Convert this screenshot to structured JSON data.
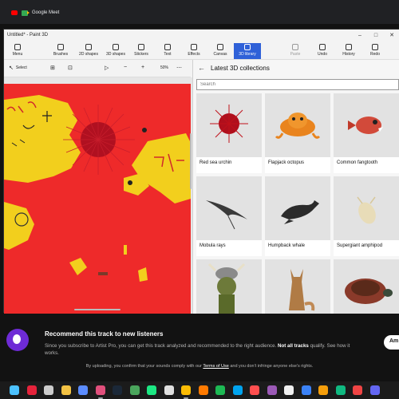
{
  "browser": {
    "tab_label": "Google Meet",
    "tab_icons": [
      "youtube-icon",
      "google-meet-icon"
    ]
  },
  "window": {
    "title": "Untitled* - Paint 3D",
    "controls": [
      "minimize-icon",
      "maximize-icon",
      "close-icon"
    ]
  },
  "ribbon": {
    "items": [
      {
        "label": "Menu",
        "icon": "folder-icon"
      },
      {
        "label": "Brushes",
        "icon": "brush-icon"
      },
      {
        "label": "2D shapes",
        "icon": "2d-shapes-icon"
      },
      {
        "label": "3D shapes",
        "icon": "3d-shapes-icon"
      },
      {
        "label": "Stickers",
        "icon": "stickers-icon"
      },
      {
        "label": "Text",
        "icon": "text-icon"
      },
      {
        "label": "Effects",
        "icon": "effects-icon"
      },
      {
        "label": "Canvas",
        "icon": "canvas-icon"
      },
      {
        "label": "3D library",
        "icon": "3d-library-icon",
        "active": true
      }
    ],
    "right_items": [
      {
        "label": "Paste",
        "icon": "paste-icon",
        "disabled": true
      },
      {
        "label": "Undo",
        "icon": "undo-icon"
      },
      {
        "label": "History",
        "icon": "history-icon"
      },
      {
        "label": "Redo",
        "icon": "redo-icon"
      }
    ]
  },
  "toolbar": {
    "select_label": "Select",
    "zoom_level": "50%",
    "icons": [
      "select-icon",
      "crop-icon",
      "magic-select-icon",
      "view-icon",
      "zoom-out-icon",
      "zoom-in-icon",
      "more-icon"
    ]
  },
  "library": {
    "title": "Latest 3D collections",
    "search_placeholder": "Search",
    "items": [
      {
        "label": "Red sea urchin",
        "color": "#c0111a"
      },
      {
        "label": "Flapjack octopus",
        "color": "#e9841e"
      },
      {
        "label": "Common fangtooth",
        "color": "#d24a3a"
      },
      {
        "label": "Mobula rays",
        "color": "#3a3a3a"
      },
      {
        "label": "Humpback whale",
        "color": "#2b2b2b"
      },
      {
        "label": "Supergiant amphipod",
        "color": "#e8dcb8"
      },
      {
        "label": "",
        "color": "#6d7a3a"
      },
      {
        "label": "",
        "color": "#b07b45"
      },
      {
        "label": "",
        "color": "#8a3a2a"
      }
    ]
  },
  "notification": {
    "title": "Recommend this track to new listeners",
    "body_prefix": "Since you subscribe to Artist Pro, you can get this track analyzed and recommended to the right audience. ",
    "body_bold": "Not all tracks",
    "body_tail": "qualify. See how it works.",
    "button": "Am"
  },
  "terms": {
    "prefix": "By uploading, you confirm that your sounds comply with our ",
    "link": "Terms of Use",
    "suffix": " and you don't infringe anyone else's rights."
  },
  "taskbar": {
    "icons": [
      {
        "name": "start-icon",
        "color": "#4cc2ff"
      },
      {
        "name": "opera-icon",
        "color": "#e5233b"
      },
      {
        "name": "task-view-icon",
        "color": "#cccccc"
      },
      {
        "name": "file-explorer-icon",
        "color": "#f3c244"
      },
      {
        "name": "app-icon",
        "color": "#5b8cff"
      },
      {
        "name": "paint-3d-icon",
        "color": "#e04f7c",
        "running": true
      },
      {
        "name": "steam-icon",
        "color": "#1b2838"
      },
      {
        "name": "app-icon-2",
        "color": "#4aa55c"
      },
      {
        "name": "hulu-icon",
        "color": "#1ce783"
      },
      {
        "name": "epic-games-icon",
        "color": "#e0e0e0"
      },
      {
        "name": "chrome-icon",
        "color": "#fbbc04",
        "running": true
      },
      {
        "name": "app-icon-3",
        "color": "#ff7a00"
      },
      {
        "name": "spotify-icon",
        "color": "#1db954"
      },
      {
        "name": "app-icon-4",
        "color": "#00a3ee"
      },
      {
        "name": "app-icon-5",
        "color": "#ff4f4f"
      },
      {
        "name": "app-icon-6",
        "color": "#9b59b6"
      },
      {
        "name": "app-icon-7",
        "color": "#f0f0f0"
      },
      {
        "name": "app-icon-8",
        "color": "#3b82f6"
      },
      {
        "name": "app-icon-9",
        "color": "#f59e0b"
      },
      {
        "name": "app-icon-10",
        "color": "#10b981"
      },
      {
        "name": "app-icon-11",
        "color": "#ef4444"
      },
      {
        "name": "app-icon-12",
        "color": "#6366f1"
      }
    ]
  },
  "colors": {
    "accent": "#2f61d8",
    "canvas_bg": "#ee2a2a",
    "drawing_yellow": "#f2cf1d"
  }
}
